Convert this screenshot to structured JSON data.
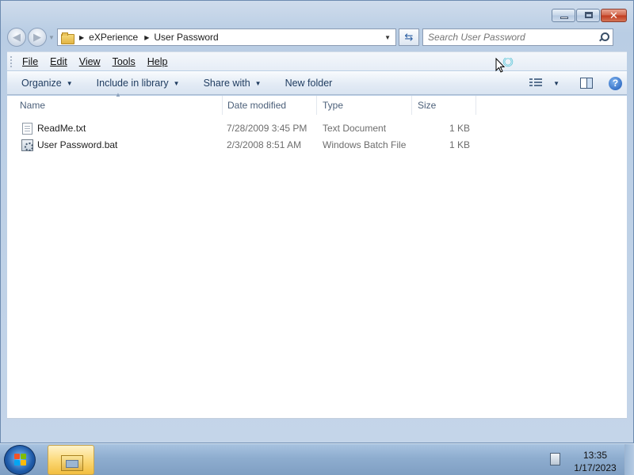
{
  "window": {
    "breadcrumb": [
      "eXPerience",
      "User Password"
    ],
    "search_placeholder": "Search User Password"
  },
  "icons": {
    "back": "back-arrow-icon",
    "forward": "forward-arrow-icon",
    "refresh": "refresh-icon",
    "search": "search-icon",
    "views": "views-icon",
    "preview_pane": "preview-pane-icon",
    "help": "help-icon",
    "folder": "folder-icon",
    "text_file": "text-file-icon",
    "batch_file": "batch-file-icon",
    "start": "windows-start-icon",
    "explorer_task": "explorer-folder-icon",
    "tray_action": "action-center-icon",
    "cursor": "busy-cursor-icon"
  },
  "menubar": [
    "File",
    "Edit",
    "View",
    "Tools",
    "Help"
  ],
  "commands": {
    "organize": "Organize",
    "include_in_library": "Include in library",
    "share_with": "Share with",
    "new_folder": "New folder"
  },
  "columns": {
    "name": "Name",
    "date_modified": "Date modified",
    "type": "Type",
    "size": "Size"
  },
  "files": [
    {
      "name": "ReadMe.txt",
      "date_modified": "7/28/2009 3:45 PM",
      "type": "Text Document",
      "size": "1 KB"
    },
    {
      "name": "User Password.bat",
      "date_modified": "2/3/2008 8:51 AM",
      "type": "Windows Batch File",
      "size": "1 KB"
    }
  ],
  "taskbar": {
    "time": "13:35",
    "date": "1/17/2023"
  },
  "colors": {
    "window_frame": "#c4d5e9",
    "taskbar": "#8eadcf",
    "command_text": "#1e3b5f",
    "close_button": "#c0391d"
  }
}
